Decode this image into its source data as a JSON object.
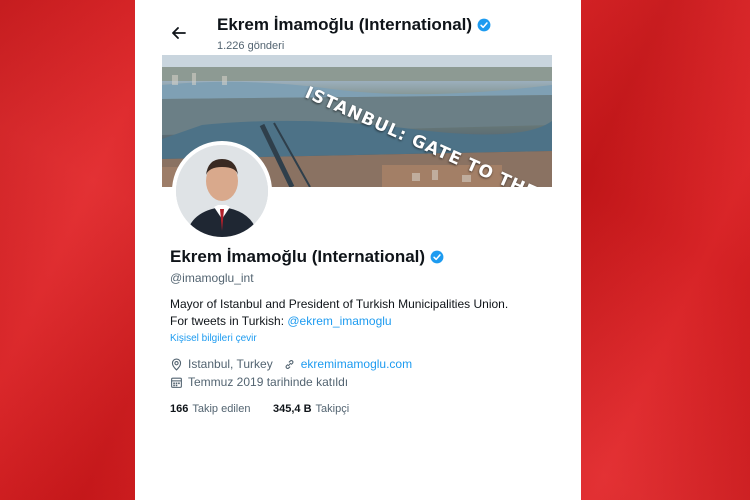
{
  "header": {
    "back_icon": "arrow-left-icon",
    "title": "Ekrem İmamoğlu (International)",
    "post_count": "1.226 gönderi"
  },
  "banner": {
    "text": "ISTANBUL: GATE TO THE BEYOND"
  },
  "profile": {
    "name": "Ekrem İmamoğlu (International)",
    "handle": "@imamoglu_int",
    "bio_line1": "Mayor of Istanbul and President of Turkish Municipalities Union.",
    "bio_line2_prefix": "For tweets in Turkish: ",
    "bio_mention": "@ekrem_imamoglu",
    "translate_label": "Kişisel bilgileri çevir",
    "location": "Istanbul, Turkey",
    "website": "ekremimamoglu.com",
    "joined": "Temmuz 2019 tarihinde katıldı",
    "following_count": "166",
    "following_label": "Takip edilen",
    "followers_count": "345,4 B",
    "followers_label": "Takipçi"
  },
  "colors": {
    "background": "#e0191c",
    "accent": "#1d9bf0",
    "text": "#0f1419",
    "muted": "#536471"
  }
}
